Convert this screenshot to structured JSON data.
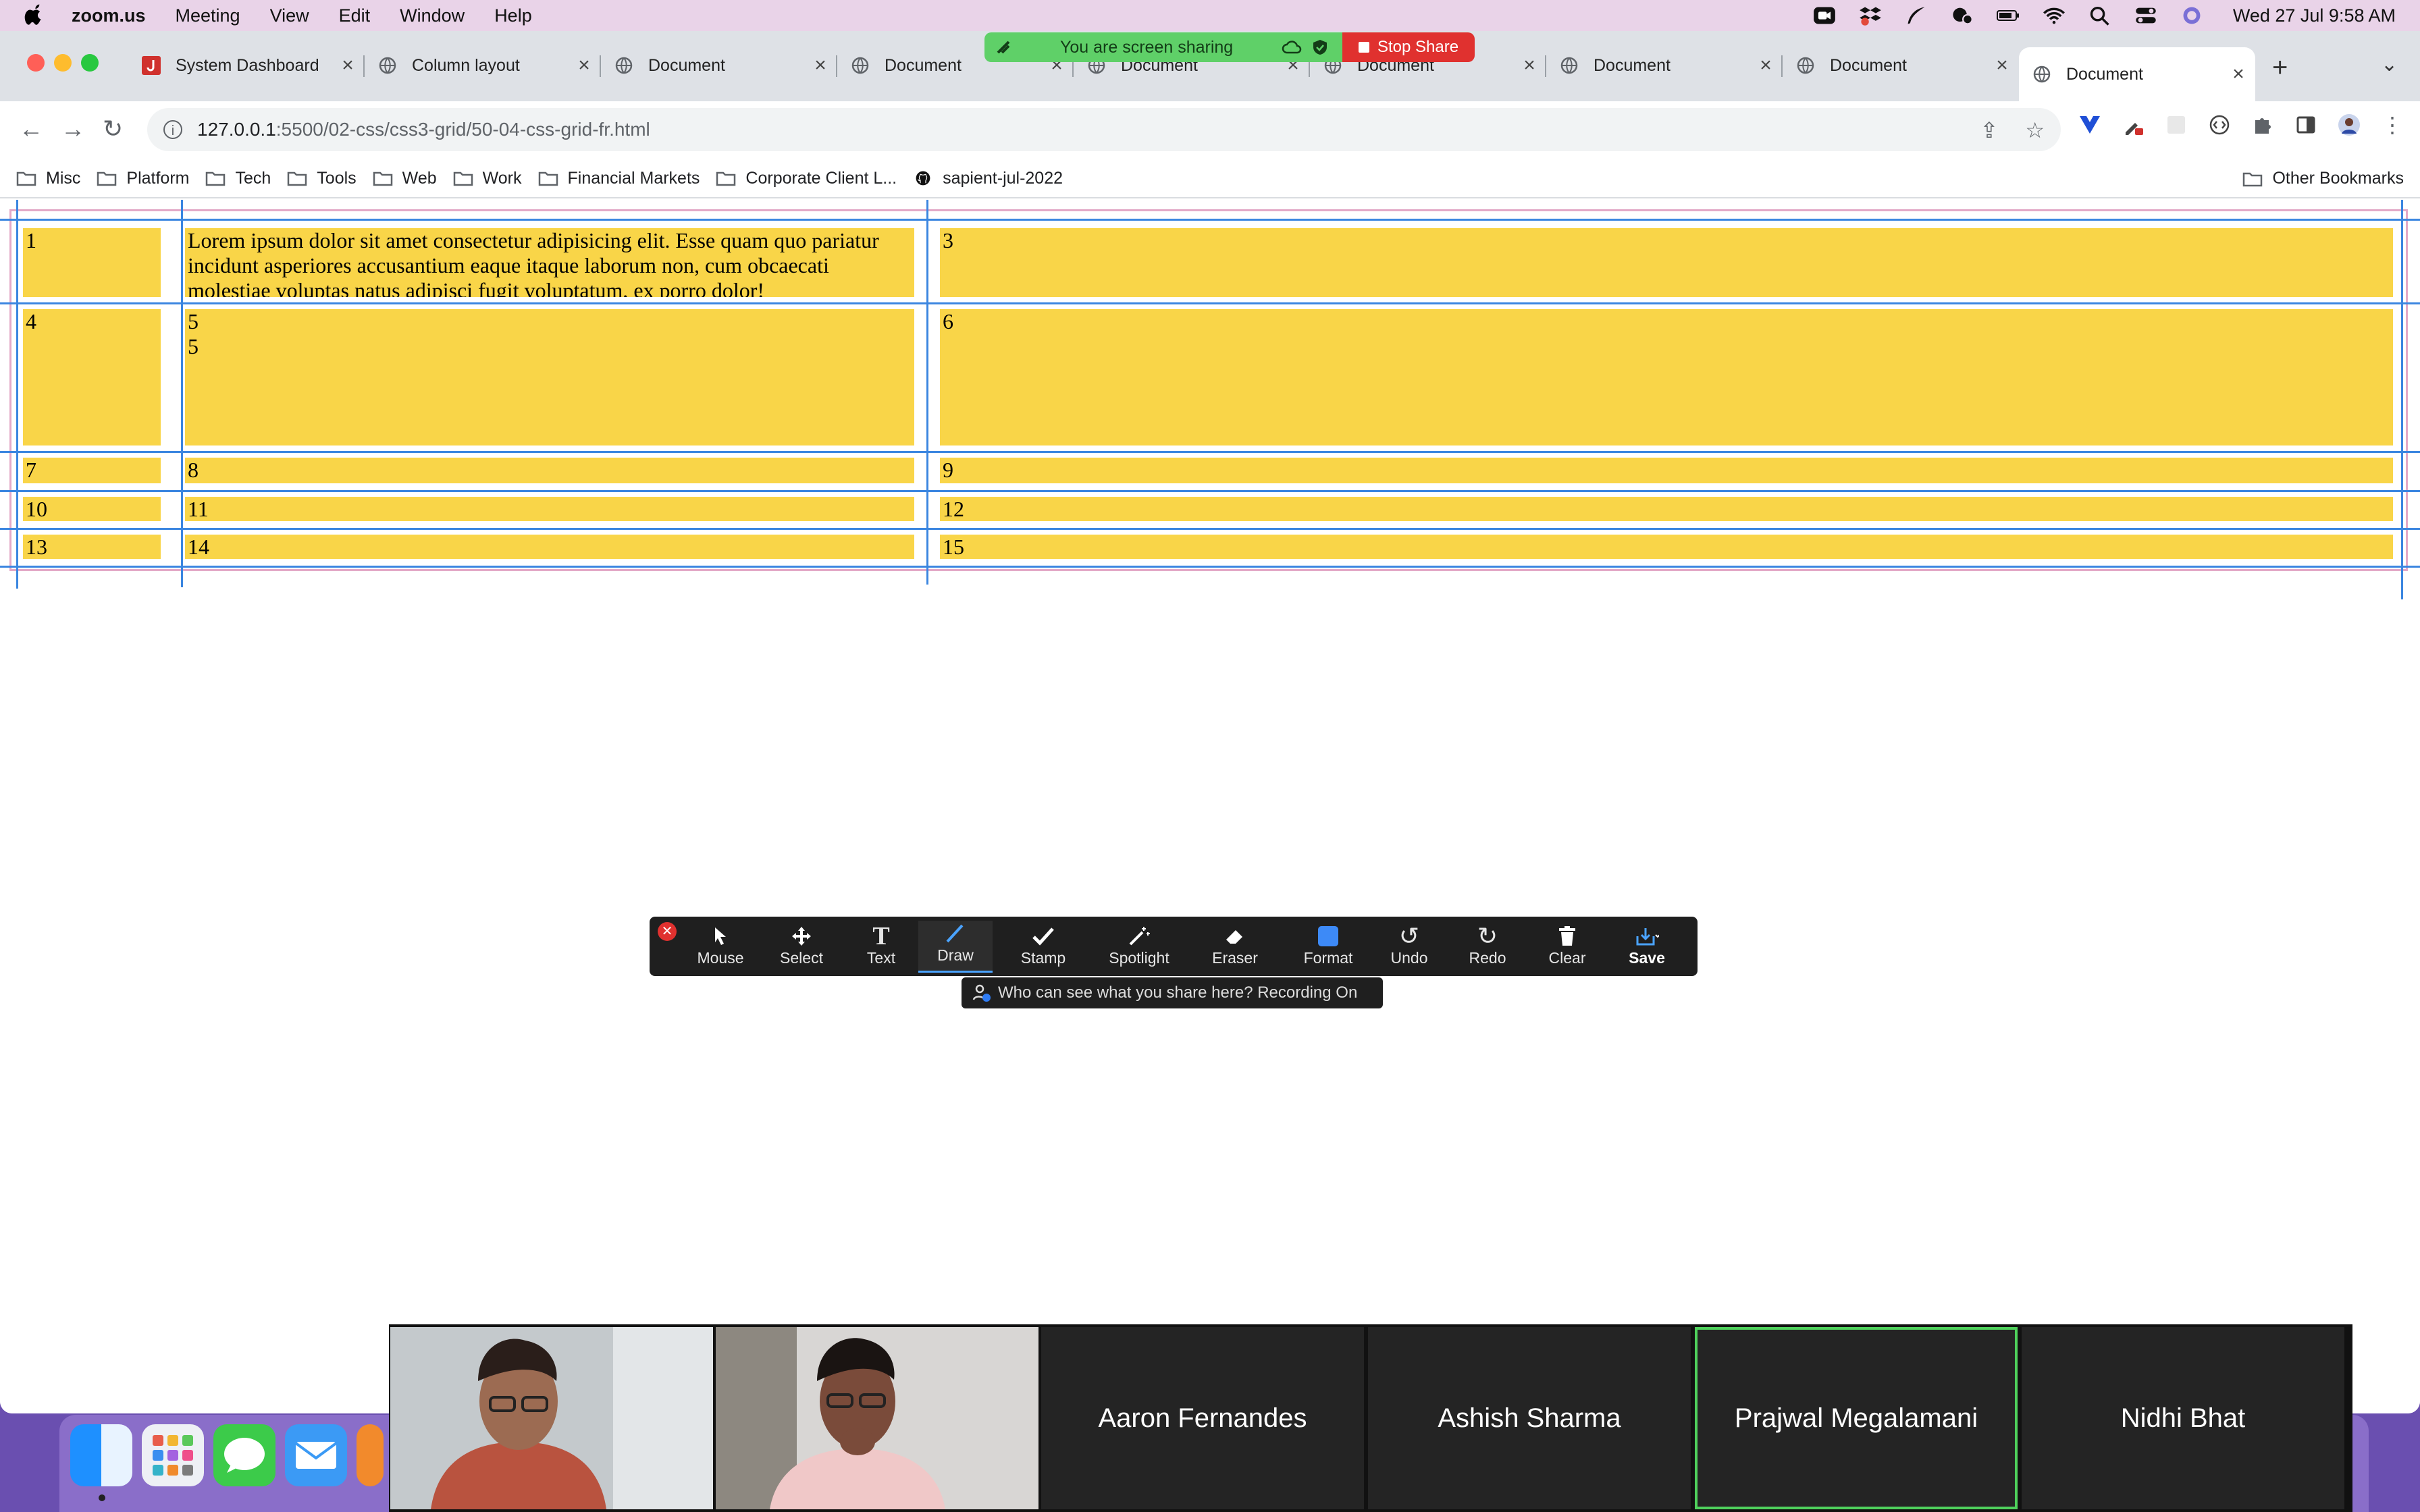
{
  "menubar": {
    "app_name": "zoom.us",
    "items": [
      "Meeting",
      "View",
      "Edit",
      "Window",
      "Help"
    ],
    "clock": "Wed 27 Jul  9:58 AM"
  },
  "screen_share": {
    "status": "You are screen sharing",
    "stop_label": "Stop Share"
  },
  "browser": {
    "tabs": [
      {
        "label": "System Dashboard",
        "icon": "jira-icon"
      },
      {
        "label": "Column layout",
        "icon": "globe-icon"
      },
      {
        "label": "Document",
        "icon": "globe-icon"
      },
      {
        "label": "Document",
        "icon": "globe-icon"
      },
      {
        "label": "Document",
        "icon": "globe-icon"
      },
      {
        "label": "Document",
        "icon": "globe-icon"
      },
      {
        "label": "Document",
        "icon": "globe-icon"
      },
      {
        "label": "Document",
        "icon": "globe-icon"
      },
      {
        "label": "Document",
        "icon": "globe-icon",
        "active": true
      }
    ],
    "url_host": "127.0.0.1",
    "url_path": ":5500/02-css/css3-grid/50-04-css-grid-fr.html",
    "bookmarks": [
      "Misc",
      "Platform",
      "Tech",
      "Tools",
      "Web",
      "Work",
      "Financial Markets",
      "Corporate Client L...",
      "sapient-jul-2022"
    ],
    "other_bookmarks": "Other Bookmarks"
  },
  "grid": {
    "items": [
      "1",
      "Lorem ipsum dolor sit amet consectetur adipisicing elit. Esse quam quo pariatur incidunt asperiores accusantium eaque itaque laborum non, cum obcaecati molestiae voluptas natus adipisci fugit voluptatum, ex porro dolor!",
      "3",
      "4",
      "5\n5",
      "6",
      "7",
      "8",
      "9",
      "10",
      "11",
      "12",
      "13",
      "14",
      "15"
    ],
    "cell_color": "#f9d548",
    "gridline_color": "#3b86e0"
  },
  "annotate": {
    "tools": [
      "Mouse",
      "Select",
      "Text",
      "Draw",
      "Stamp",
      "Spotlight",
      "Eraser",
      "Format",
      "Undo",
      "Redo",
      "Clear",
      "Save"
    ],
    "active_tool": "Draw",
    "note": "Who can see what you share here? Recording On"
  },
  "participants": [
    "Aaron Fernandes",
    "Ashish Sharma",
    "Prajwal Megalamani",
    "Nidhi Bhat"
  ]
}
